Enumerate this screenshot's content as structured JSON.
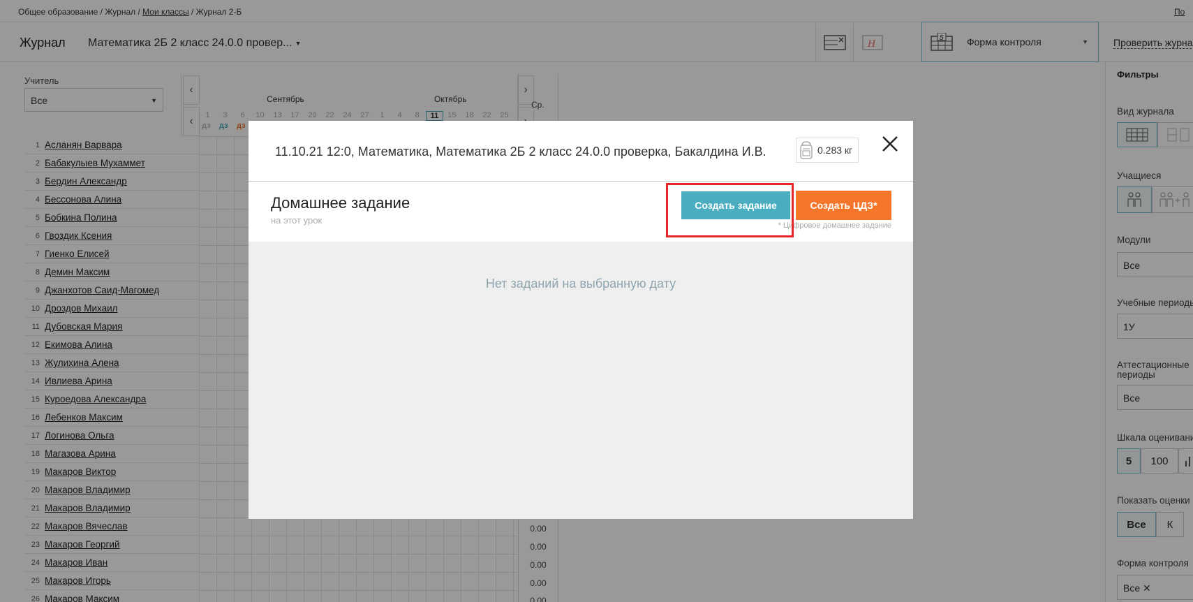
{
  "breadcrumb": {
    "part1": "Общее образование / Журнал / ",
    "link": "Мои классы",
    "part2": " / Журнал 2-Б",
    "right_link": "По"
  },
  "header": {
    "title": "Журнал",
    "subject": "Математика 2Б 2 класс 24.0.0 провер...",
    "form_control": "Форма контроля",
    "check_link": "Проверить журнал"
  },
  "teacher": {
    "label": "Учитель",
    "value": "Все"
  },
  "students": [
    {
      "num": "1",
      "name": "Асланян Варвара"
    },
    {
      "num": "2",
      "name": "Бабакулыев Мухаммет"
    },
    {
      "num": "3",
      "name": "Бердин Александр"
    },
    {
      "num": "4",
      "name": "Бессонова Алина"
    },
    {
      "num": "5",
      "name": "Бобкина Полина"
    },
    {
      "num": "6",
      "name": "Гвоздик Ксения"
    },
    {
      "num": "7",
      "name": "Гиенко Елисей"
    },
    {
      "num": "8",
      "name": "Демин Максим"
    },
    {
      "num": "9",
      "name": "Джанхотов Саид-Магомед"
    },
    {
      "num": "10",
      "name": "Дроздов Михаил"
    },
    {
      "num": "11",
      "name": "Дубовская Мария"
    },
    {
      "num": "12",
      "name": "Екимова Алина"
    },
    {
      "num": "13",
      "name": "Жулихина Алена"
    },
    {
      "num": "14",
      "name": "Ивлиева Арина"
    },
    {
      "num": "15",
      "name": "Куроедова Александра"
    },
    {
      "num": "16",
      "name": "Лебенков Максим"
    },
    {
      "num": "17",
      "name": "Логинова Ольга"
    },
    {
      "num": "18",
      "name": "Магазова Арина"
    },
    {
      "num": "19",
      "name": "Макаров Виктор"
    },
    {
      "num": "20",
      "name": "Макаров Владимир"
    },
    {
      "num": "21",
      "name": "Макаров Владимир"
    },
    {
      "num": "22",
      "name": "Макаров Вячеслав"
    },
    {
      "num": "23",
      "name": "Макаров Георгий"
    },
    {
      "num": "24",
      "name": "Макаров Иван"
    },
    {
      "num": "25",
      "name": "Макаров Игорь"
    },
    {
      "num": "26",
      "name": "Макаров Максим"
    }
  ],
  "calendar": {
    "months": [
      "Сентябрь",
      "Октябрь"
    ],
    "days": [
      "1",
      "3",
      "6",
      "10",
      "13",
      "17",
      "20",
      "22",
      "24",
      "27",
      "1",
      "4",
      "8",
      "11",
      "15",
      "18",
      "22",
      "25"
    ],
    "today": "11",
    "dz_labels": [
      "дз",
      "дз",
      "дз"
    ],
    "avg_label": "Ср.",
    "avg_values": [
      "0.00",
      "0.00",
      "0.00",
      "0.00",
      "0.00"
    ]
  },
  "sidebar": {
    "title": "Фильтры",
    "view_label": "Вид журнала",
    "students_label": "Учащиеся",
    "modules_label": "Модули",
    "modules_value": "Все",
    "periods_label": "Учебные периоды",
    "periods_value": "1У",
    "att_label_1": "Аттестационные",
    "att_label_2": "периоды",
    "att_value": "Все",
    "scale_label": "Шкала оценивания",
    "scale_options": [
      "5",
      "100"
    ],
    "show_label": "Показать оценки",
    "show_options": [
      "Все",
      "К"
    ],
    "form_label": "Форма контроля",
    "form_value": "Все ✕"
  },
  "modal": {
    "info": "11.10.21 12:0, Математика, Математика 2Б 2 класс 24.0.0 проверка, Бакалдина И.В.",
    "weight": "0.283 кг",
    "hw_title": "Домашнее задание",
    "hw_sub": "на этот урок",
    "create_btn": "Создать задание",
    "cdz_btn": "Создать ЦДЗ*",
    "cdz_note": "* Цифровое домашнее задание",
    "empty": "Нет заданий на выбранную дату"
  },
  "colors": {
    "accent": "#4badc0",
    "orange": "#f5752b",
    "highlight": "#e8262a"
  }
}
